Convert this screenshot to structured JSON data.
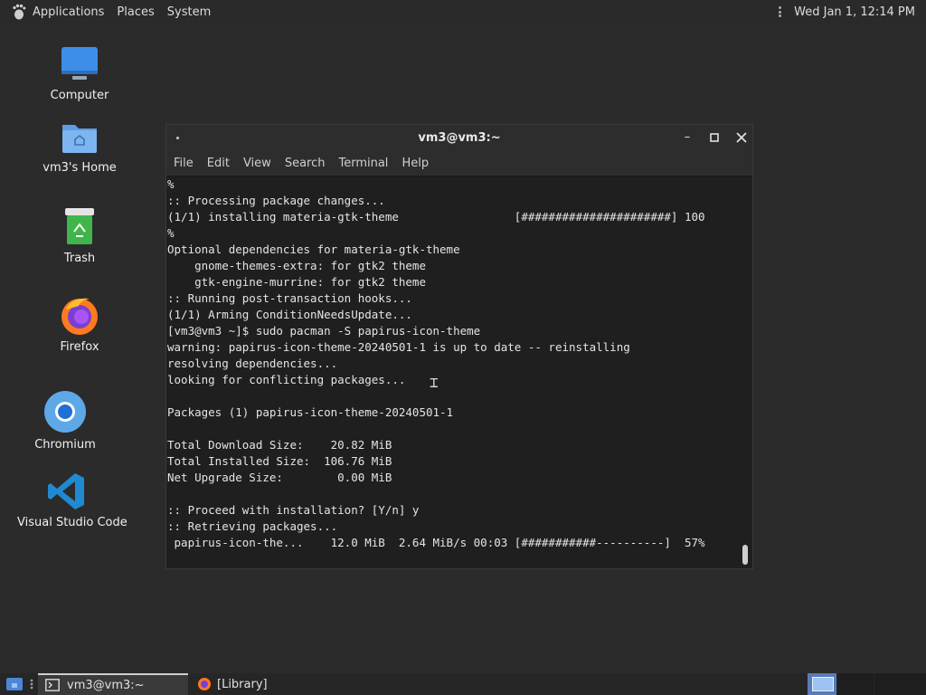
{
  "top_panel": {
    "menus": [
      "Applications",
      "Places",
      "System"
    ],
    "clock": "Wed Jan 1, 12:14 PM"
  },
  "desktop": {
    "icons": [
      {
        "label": "Computer",
        "icon": "computer-icon"
      },
      {
        "label": "vm3's Home",
        "icon": "home-folder-icon"
      },
      {
        "label": "Trash",
        "icon": "trash-icon"
      },
      {
        "label": "Firefox",
        "icon": "firefox-icon"
      },
      {
        "label": "Chromium",
        "icon": "chromium-icon"
      },
      {
        "label": "Visual Studio Code",
        "icon": "vscode-icon"
      }
    ]
  },
  "terminal": {
    "title": "vm3@vm3:~",
    "menu": [
      "File",
      "Edit",
      "View",
      "Search",
      "Terminal",
      "Help"
    ],
    "lines": [
      "%",
      ":: Processing package changes...",
      "(1/1) installing materia-gtk-theme                 [######################] 100",
      "%",
      "Optional dependencies for materia-gtk-theme",
      "    gnome-themes-extra: for gtk2 theme",
      "    gtk-engine-murrine: for gtk2 theme",
      ":: Running post-transaction hooks...",
      "(1/1) Arming ConditionNeedsUpdate...",
      "[vm3@vm3 ~]$ sudo pacman -S papirus-icon-theme",
      "warning: papirus-icon-theme-20240501-1 is up to date -- reinstalling",
      "resolving dependencies...",
      "looking for conflicting packages...",
      "",
      "Packages (1) papirus-icon-theme-20240501-1",
      "",
      "Total Download Size:    20.82 MiB",
      "Total Installed Size:  106.76 MiB",
      "Net Upgrade Size:        0.00 MiB",
      "",
      ":: Proceed with installation? [Y/n] y",
      ":: Retrieving packages...",
      " papirus-icon-the...    12.0 MiB  2.64 MiB/s 00:03 [###########----------]  57%"
    ]
  },
  "taskbar": {
    "terminal_task": "vm3@vm3:~",
    "library_task": "[Library]"
  },
  "colors": {
    "desktop_bg": "#2b2b2b",
    "terminal_bg": "#1f1f1f",
    "workspace_active": "#5a7bb8"
  }
}
